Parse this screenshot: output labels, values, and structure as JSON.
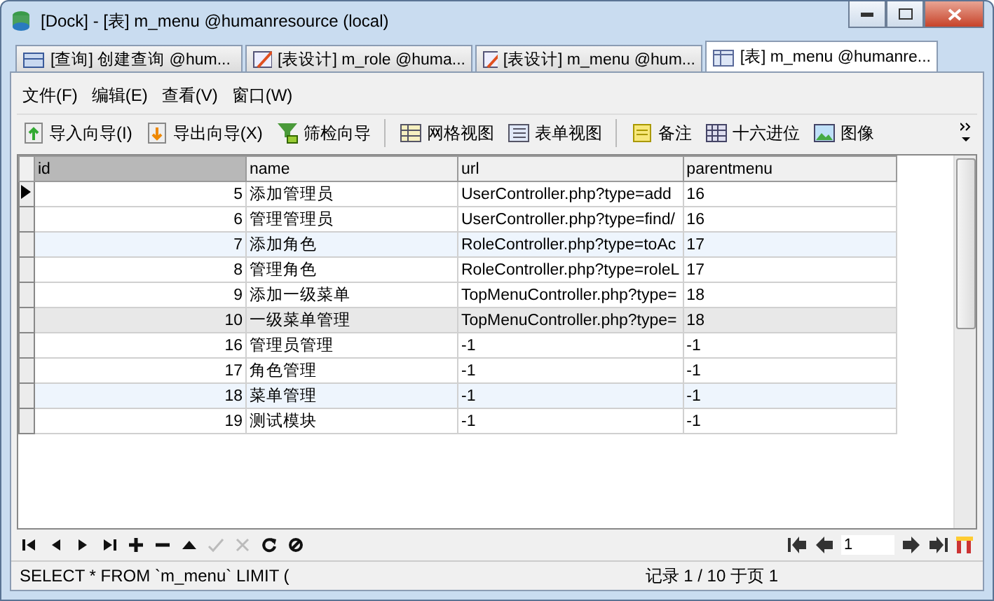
{
  "window": {
    "title": "[Dock] - [表] m_menu @humanresource (local)"
  },
  "tabs": [
    {
      "label": "[查询] 创建查询 @hum...",
      "kind": "query",
      "selected": false
    },
    {
      "label": "[表设计] m_role @huma...",
      "kind": "design",
      "selected": false
    },
    {
      "label": "[表设计] m_menu @hum...",
      "kind": "design",
      "selected": false
    },
    {
      "label": "[表] m_menu @humanre...",
      "kind": "table",
      "selected": true
    }
  ],
  "menu": [
    "文件(F)",
    "编辑(E)",
    "查看(V)",
    "窗口(W)"
  ],
  "toolbar": [
    {
      "label": "导入向导(I)",
      "kind": "import"
    },
    {
      "label": "导出向导(X)",
      "kind": "export"
    },
    {
      "label": "筛检向导",
      "kind": "filter"
    },
    {
      "kind": "sep"
    },
    {
      "label": "网格视图",
      "kind": "grid"
    },
    {
      "label": "表单视图",
      "kind": "form"
    },
    {
      "kind": "sep"
    },
    {
      "label": "备注",
      "kind": "memo"
    },
    {
      "label": "十六进位",
      "kind": "hex"
    },
    {
      "label": "图像",
      "kind": "image"
    }
  ],
  "table": {
    "columns": [
      "id",
      "name",
      "url",
      "parentmenu"
    ],
    "rows": [
      {
        "cells": [
          "5",
          "添加管理员",
          "UserController.php?type=add",
          "16"
        ],
        "current": true,
        "highlighted": false,
        "selected": false
      },
      {
        "cells": [
          "6",
          "管理管理员",
          "UserController.php?type=find/",
          "16"
        ],
        "current": false,
        "highlighted": false,
        "selected": false
      },
      {
        "cells": [
          "7",
          "添加角色",
          "RoleController.php?type=toAc",
          "17"
        ],
        "current": false,
        "highlighted": true,
        "selected": false
      },
      {
        "cells": [
          "8",
          "管理角色",
          "RoleController.php?type=roleL",
          "17"
        ],
        "current": false,
        "highlighted": false,
        "selected": false
      },
      {
        "cells": [
          "9",
          "添加一级菜单",
          "TopMenuController.php?type=",
          "18"
        ],
        "current": false,
        "highlighted": false,
        "selected": false
      },
      {
        "cells": [
          "10",
          "一级菜单管理",
          "TopMenuController.php?type=",
          "18"
        ],
        "current": false,
        "highlighted": false,
        "selected": true
      },
      {
        "cells": [
          "16",
          "管理员管理",
          "-1",
          "-1"
        ],
        "current": false,
        "highlighted": false,
        "selected": false
      },
      {
        "cells": [
          "17",
          "角色管理",
          "-1",
          "-1"
        ],
        "current": false,
        "highlighted": false,
        "selected": false
      },
      {
        "cells": [
          "18",
          "菜单管理",
          "-1",
          "-1"
        ],
        "current": false,
        "highlighted": true,
        "selected": false
      },
      {
        "cells": [
          "19",
          "测试模块",
          "-1",
          "-1"
        ],
        "current": false,
        "highlighted": false,
        "selected": false
      }
    ]
  },
  "nav": [
    {
      "kind": "first",
      "disabled": false
    },
    {
      "kind": "prev",
      "disabled": false
    },
    {
      "kind": "next",
      "disabled": false
    },
    {
      "kind": "last",
      "disabled": false
    },
    {
      "kind": "add",
      "disabled": false
    },
    {
      "kind": "delete",
      "disabled": false
    },
    {
      "kind": "up",
      "disabled": false
    },
    {
      "kind": "apply",
      "disabled": true
    },
    {
      "kind": "cancel",
      "disabled": true
    },
    {
      "kind": "refresh",
      "disabled": false
    },
    {
      "kind": "stop",
      "disabled": false
    }
  ],
  "pager": {
    "page": "1"
  },
  "status": {
    "sql": "SELECT * FROM `m_menu` LIMIT (",
    "records": "记录 1 / 10 于页 1"
  }
}
